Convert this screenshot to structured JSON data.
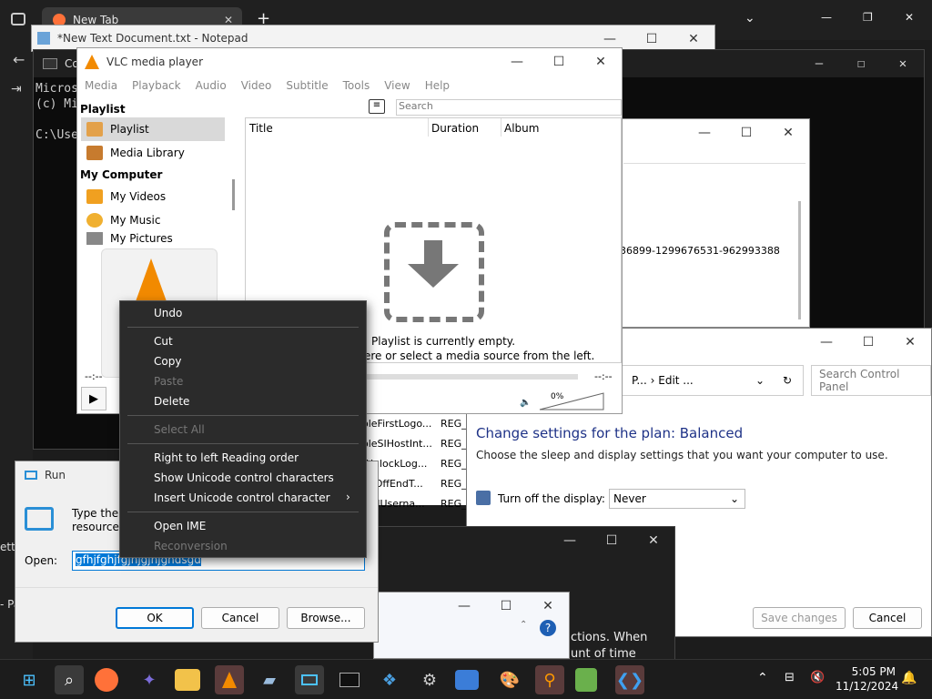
{
  "browser": {
    "tab_title": "New Tab",
    "new_tab": "+"
  },
  "notepad": {
    "title": "*New Text Document.txt - Notepad"
  },
  "cmd": {
    "title": "Co",
    "lines": [
      "Micros",
      "(c) Mi",
      "",
      "C:\\Use"
    ]
  },
  "regedit": {
    "sid_text": "36899-1299676531-962993388",
    "rows": [
      {
        "name": "oleFirstLogo...",
        "type": "REG_"
      },
      {
        "name": "oleSIHostInt...",
        "type": "REG_"
      },
      {
        "name": "-UnlockLog...",
        "type": "REG_"
      },
      {
        "name": "ogOffEndT...",
        "type": "REG_"
      },
      {
        "name": "sedUserna...",
        "type": "REG_"
      }
    ]
  },
  "control_panel": {
    "breadcrumb": "P...  ›  Edit ...",
    "search_placeholder": "Search Control Panel",
    "heading": "Change settings for the plan: Balanced",
    "subtext": "Choose the sleep and display settings that you want your computer to use.",
    "display_label": "Turn off the display:",
    "display_value": "Never",
    "save_label": "Save changes",
    "cancel_label": "Cancel"
  },
  "dark_window": {
    "text_1": "ctions. When",
    "text_2": "unt of time"
  },
  "vlc": {
    "title": "VLC media player",
    "menu": [
      "Media",
      "Playback",
      "Audio",
      "Video",
      "Subtitle",
      "Tools",
      "View",
      "Help"
    ],
    "search_placeholder": "Search",
    "sidebar": {
      "playlist_head": "Playlist",
      "playlist_item": "Playlist",
      "media_library": "Media Library",
      "my_computer_head": "My Computer",
      "my_videos": "My Videos",
      "my_music": "My Music",
      "my_pictures": "My Pictures"
    },
    "columns": [
      "Title",
      "Duration",
      "Album"
    ],
    "empty_1": "Playlist is currently empty.",
    "empty_2": "ere or select a media source from the left.",
    "time_left": "--:--",
    "time_right": "--:--",
    "volume": "0%"
  },
  "context_menu": {
    "undo": "Undo",
    "cut": "Cut",
    "copy": "Copy",
    "paste": "Paste",
    "delete": "Delete",
    "select_all": "Select All",
    "rtl": "Right to left Reading order",
    "show_unicode": "Show Unicode control characters",
    "insert_unicode": "Insert Unicode control character",
    "open_ime": "Open IME",
    "reconversion": "Reconversion"
  },
  "run": {
    "title": "Run",
    "desc_1": "Type the n",
    "desc_2": "resource, a",
    "open_label": "Open:",
    "open_value": "gfhjfghjfgjhjgjhjghdsgd",
    "ok": "OK",
    "cancel": "Cancel",
    "browse": "Browse..."
  },
  "background_left": {
    "text_1": "etti",
    "text_2": "- Pa"
  },
  "taskbar": {
    "time": "5:05 PM",
    "date": "11/12/2024"
  },
  "colors": {
    "accent": "#0067c0",
    "vlc_orange": "#f28a00",
    "selection": "#0078d7"
  }
}
